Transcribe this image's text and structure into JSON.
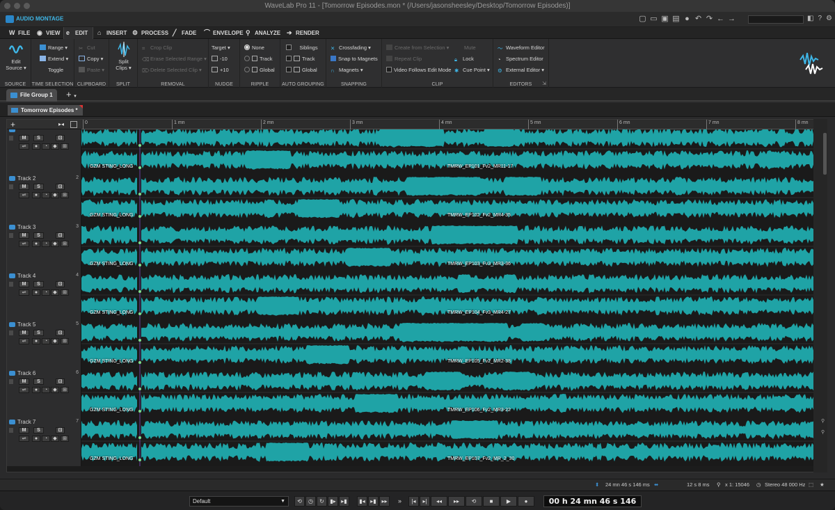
{
  "window": {
    "title": "WaveLab Pro 11 - [Tomorrow Episodes.mon * (/Users/jasonsheesley/Desktop/Tomorrow Episodes)]"
  },
  "app": {
    "mode": "AUDIO MONTAGE"
  },
  "menu_tabs": [
    {
      "label": "FILE",
      "icon": "wavelab-icon"
    },
    {
      "label": "VIEW",
      "icon": "eye-icon"
    },
    {
      "label": "EDIT",
      "icon": "edit-icon",
      "active": true
    },
    {
      "label": "INSERT",
      "icon": "insert-icon"
    },
    {
      "label": "PROCESS",
      "icon": "process-icon"
    },
    {
      "label": "FADE",
      "icon": "fade-icon"
    },
    {
      "label": "ENVELOPE",
      "icon": "envelope-icon"
    },
    {
      "label": "ANALYZE",
      "icon": "analyze-icon"
    },
    {
      "label": "RENDER",
      "icon": "render-icon"
    }
  ],
  "ribbon": {
    "source": {
      "label": "SOURCE",
      "edit_source": "Edit\nSource"
    },
    "time_selection": {
      "label": "TIME SELECTION",
      "range": "Range",
      "extend": "Extend",
      "toggle": "Toggle"
    },
    "clipboard": {
      "label": "CLIPBOARD",
      "cut": "Cut",
      "copy": "Copy",
      "paste": "Paste"
    },
    "split": {
      "label": "SPLIT",
      "split_clips": "Split\nClips"
    },
    "removal": {
      "label": "REMOVAL",
      "crop_clip": "Crop Clip",
      "erase_selected_range": "Erase Selected Range",
      "delete_selected_clip": "Delete Selected Clip"
    },
    "nudge": {
      "label": "NUDGE",
      "target": "Target",
      "minus": "-10",
      "plus": "+10"
    },
    "ripple": {
      "label": "RIPPLE",
      "none": "None",
      "track": "Track",
      "global": "Global"
    },
    "auto_grouping": {
      "label": "AUTO GROUPING",
      "siblings": "Siblings",
      "track": "Track",
      "global": "Global"
    },
    "snapping": {
      "label": "SNAPPING",
      "crossfading": "Crossfading",
      "snap_to_magnets": "Snap to Magnets",
      "magnets": "Magnets"
    },
    "clip": {
      "label": "CLIP",
      "create_from_selection": "Create from Selection",
      "repeat_clip": "Repeat Clip",
      "video_follows": "Video Follows Edit Mode",
      "mute": "Mute",
      "lock": "Lock",
      "cue_point": "Cue Point"
    },
    "editors": {
      "label": "EDITORS",
      "waveform_editor": "Waveform Editor",
      "spectrum_editor": "Spectrum Editor",
      "external_editor": "External Editor"
    }
  },
  "file_tab": {
    "label": "File Group 1"
  },
  "montage_tab": {
    "label": "Tomorrow Episodes *"
  },
  "ruler": {
    "ticks": [
      "0",
      "1 mn",
      "2 mn",
      "3 mn",
      "4 mn",
      "5 mn",
      "6 mn",
      "7 mn",
      "8 mn"
    ]
  },
  "tracks": [
    {
      "name": "",
      "num": "",
      "clip_left": "GZM STING_LONG",
      "clip_right": "TMRW_EP101_Fv2_MR11-17"
    },
    {
      "name": "Track 2",
      "num": "2",
      "clip_left": "GZM STING_LONG",
      "clip_right": "TMRW_EP102_Fv2_MR4-35"
    },
    {
      "name": "Track 3",
      "num": "3",
      "clip_left": "GZM STING_LONG",
      "clip_right": "TMRW_EP103_Fv3_MR3-36"
    },
    {
      "name": "Track 4",
      "num": "4",
      "clip_left": "GZM STING_LONG",
      "clip_right": "TMRW_EP104_Fv3_MR4-27"
    },
    {
      "name": "Track 5",
      "num": "5",
      "clip_left": "GZM STING_LONG",
      "clip_right": "TMRW_EP105_Fv2_MR2-38"
    },
    {
      "name": "Track 6",
      "num": "6",
      "clip_left": "GZM STING_LONG",
      "clip_right": "TMRW_EP106_Fv2_MR3-22"
    },
    {
      "name": "Track 7",
      "num": "7",
      "clip_left": "GZM STING_LONG",
      "clip_right": "TMRW_EP107_Fv2_MR_2_30"
    }
  ],
  "track_buttons": {
    "mute": "M",
    "solo": "S"
  },
  "status": {
    "duration": "24 mn 46 s 146 ms",
    "zoom": "12 s 8 ms",
    "ratio": "x 1: 15046",
    "format": "Stereo 48 000 Hz"
  },
  "transport": {
    "preset": "Default",
    "timecode": "00 h 24 mn 46 s 146 ms"
  },
  "colors": {
    "waveform": "#1fa3a6",
    "accent": "#3b8fd1"
  }
}
